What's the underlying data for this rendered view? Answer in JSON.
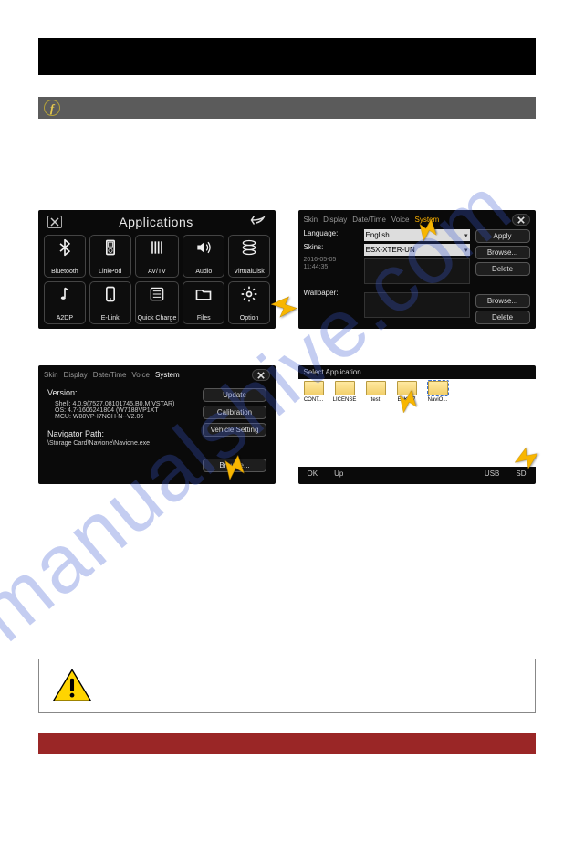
{
  "watermark": {
    "text": "manualshive.com"
  },
  "apps_screen": {
    "title": "Applications",
    "cells": [
      {
        "label": "Bluetooth",
        "icon": "✱"
      },
      {
        "label": "LinkPod",
        "icon": "▯"
      },
      {
        "label": "AV/TV",
        "icon": "|||"
      },
      {
        "label": "Audio",
        "icon": "🔊"
      },
      {
        "label": "VirtualDisk",
        "icon": "◎"
      },
      {
        "label": "A2DP",
        "icon": "♪"
      },
      {
        "label": "E-Link",
        "icon": "▭"
      },
      {
        "label": "Quick Charge",
        "icon": "▤"
      },
      {
        "label": "Files",
        "icon": "🗀"
      },
      {
        "label": "Option",
        "icon": "gear"
      }
    ]
  },
  "skin_screen": {
    "tabs": {
      "t0": "Skin",
      "t1": "Display",
      "t2": "Date/Time",
      "t3": "Voice",
      "t4": "System"
    },
    "labels": {
      "language": "Language:",
      "skins": "Skins:",
      "wallpaper": "Wallpaper:"
    },
    "fields": {
      "language_value": "English",
      "skin_value": "ESX-XTER-UN"
    },
    "timestamp": {
      "date": "2016-05-05",
      "time": "11:44:35"
    },
    "buttons": {
      "apply": "Apply",
      "browse": "Browse...",
      "delete": "Delete"
    }
  },
  "system_screen": {
    "tabs": {
      "t0": "Skin",
      "t1": "Display",
      "t2": "Date/Time",
      "t3": "Voice",
      "t4": "System"
    },
    "version_label": "Version:",
    "version_lines": {
      "l0": "Shell: 4.0.9(7527.08101745.B0.M.VSTAR)",
      "l1": "OS:   4.7-1606241804 (W7188VP1XT",
      "l2": "MCU:  W88VP-I7NCH-N--V2.06"
    },
    "nav_label": "Navigator Path:",
    "nav_path": "\\Storage Card\\Navione\\Navione.exe",
    "buttons": {
      "update": "Update",
      "calibration": "Calibration",
      "vehicle": "Vehicle Setting",
      "browse": "Browse..."
    }
  },
  "file_screen": {
    "title": "Select Application",
    "folders": {
      "f0": "CONT...",
      "f1": "LICENSE",
      "f2": "test",
      "f3": "ELK-L7",
      "f4": "NaviO..."
    },
    "bottom": {
      "ok": "OK",
      "up": "Up",
      "usb": "USB",
      "sd": "SD"
    }
  }
}
